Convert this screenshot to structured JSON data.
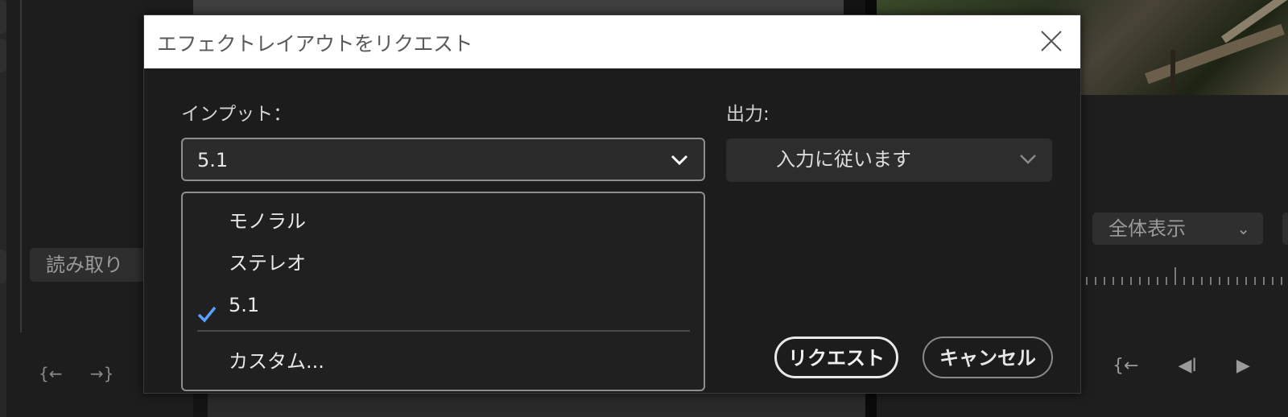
{
  "background": {
    "read_button_label": "読み取り",
    "zoom_select_value": "全体表示",
    "left_icons": [
      "{←",
      "→}"
    ],
    "transport_icons": [
      "{←",
      "◀I",
      "▶"
    ]
  },
  "dialog": {
    "title": "エフェクトレイアウトをリクエスト",
    "input": {
      "label": "インプット：",
      "selected_value": "5.1",
      "options": [
        {
          "label": "モノラル",
          "checked": false
        },
        {
          "label": "ステレオ",
          "checked": false
        },
        {
          "label": "5.1",
          "checked": true
        },
        {
          "label": "カスタム...",
          "checked": false
        }
      ]
    },
    "output": {
      "label": "出力:",
      "selected_value": "入力に従います"
    },
    "buttons": {
      "request": "リクエスト",
      "cancel": "キャンセル"
    }
  },
  "colors": {
    "check_accent": "#5aa0ff",
    "dialog_bg": "#1c1c1c",
    "titlebar_bg": "#ffffff"
  }
}
